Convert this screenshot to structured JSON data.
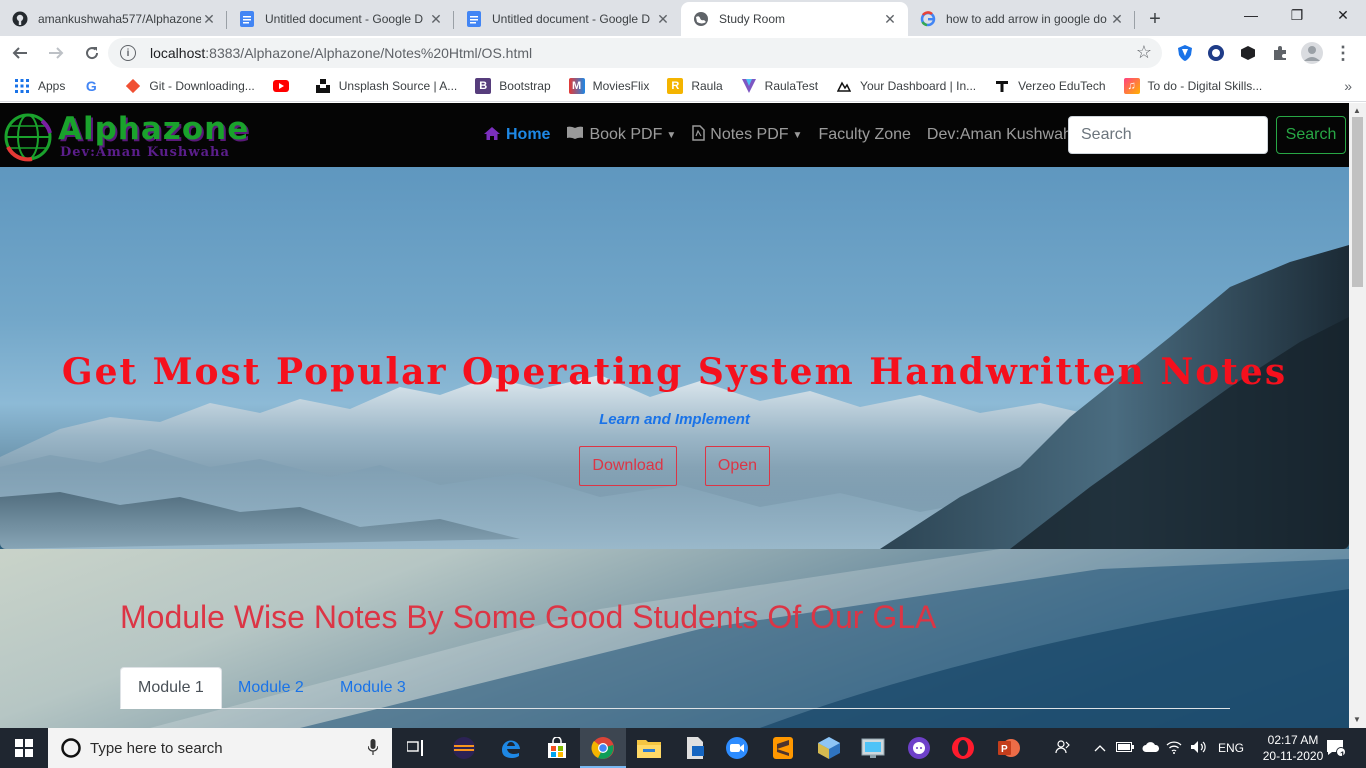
{
  "browser": {
    "tabs": [
      {
        "title": "amankushwaha577/Alphazone",
        "icon": "github-icon"
      },
      {
        "title": "Untitled document - Google D",
        "icon": "google-docs-icon"
      },
      {
        "title": "Untitled document - Google D",
        "icon": "google-docs-icon"
      },
      {
        "title": "Study Room",
        "icon": "globe-icon",
        "active": true
      },
      {
        "title": "how to add arrow in google do",
        "icon": "google-icon"
      }
    ],
    "url_host": "localhost",
    "url_rest": ":8383/Alphazone/Alphazone/Notes%20Html/OS.html",
    "bookmarks": [
      {
        "label": "Apps",
        "icon": "apps-grid-icon"
      },
      {
        "label": "",
        "icon": "google-icon"
      },
      {
        "label": "Git - Downloading...",
        "icon": "git-icon"
      },
      {
        "label": "",
        "icon": "youtube-icon"
      },
      {
        "label": "Unsplash Source | A...",
        "icon": "unsplash-icon"
      },
      {
        "label": "Bootstrap",
        "icon": "bootstrap-icon"
      },
      {
        "label": "MoviesFlix",
        "icon": "moviesflix-icon"
      },
      {
        "label": "Raula",
        "icon": "raula-icon"
      },
      {
        "label": "RaulaTest",
        "icon": "raulatest-icon"
      },
      {
        "label": "Your Dashboard | In...",
        "icon": "dashboard-icon"
      },
      {
        "label": "Verzeo EduTech",
        "icon": "verzeo-icon"
      },
      {
        "label": "To do - Digital Skills...",
        "icon": "todo-icon"
      }
    ]
  },
  "site": {
    "brand": "Alphazone",
    "dev_tag": "Dev:Aman Kushwaha",
    "nav": {
      "home": "Home",
      "book_pdf": "Book PDF",
      "notes_pdf": "Notes PDF",
      "faculty": "Faculty Zone",
      "dev": "Dev:Aman Kushwaha"
    },
    "search_placeholder": "Search",
    "search_button": "Search",
    "hero": {
      "title": "Get Most Popular Operating System Handwritten Notes",
      "subtitle": "Learn and Implement",
      "download": "Download",
      "open": "Open"
    },
    "section_title": "Module Wise Notes By Some Good Students Of Our GLA",
    "modules": [
      "Module 1",
      "Module 2",
      "Module 3"
    ]
  },
  "taskbar": {
    "search_placeholder": "Type here to search",
    "language": "ENG",
    "time": "02:17 AM",
    "date": "20-11-2020",
    "notifications": "1"
  },
  "colors": {
    "brand_green": "#1aa22c",
    "hero_red": "#f5101d",
    "accent_blue": "#1a73e8",
    "bootstrap_danger": "#dc3545",
    "bootstrap_success": "#28a745"
  }
}
